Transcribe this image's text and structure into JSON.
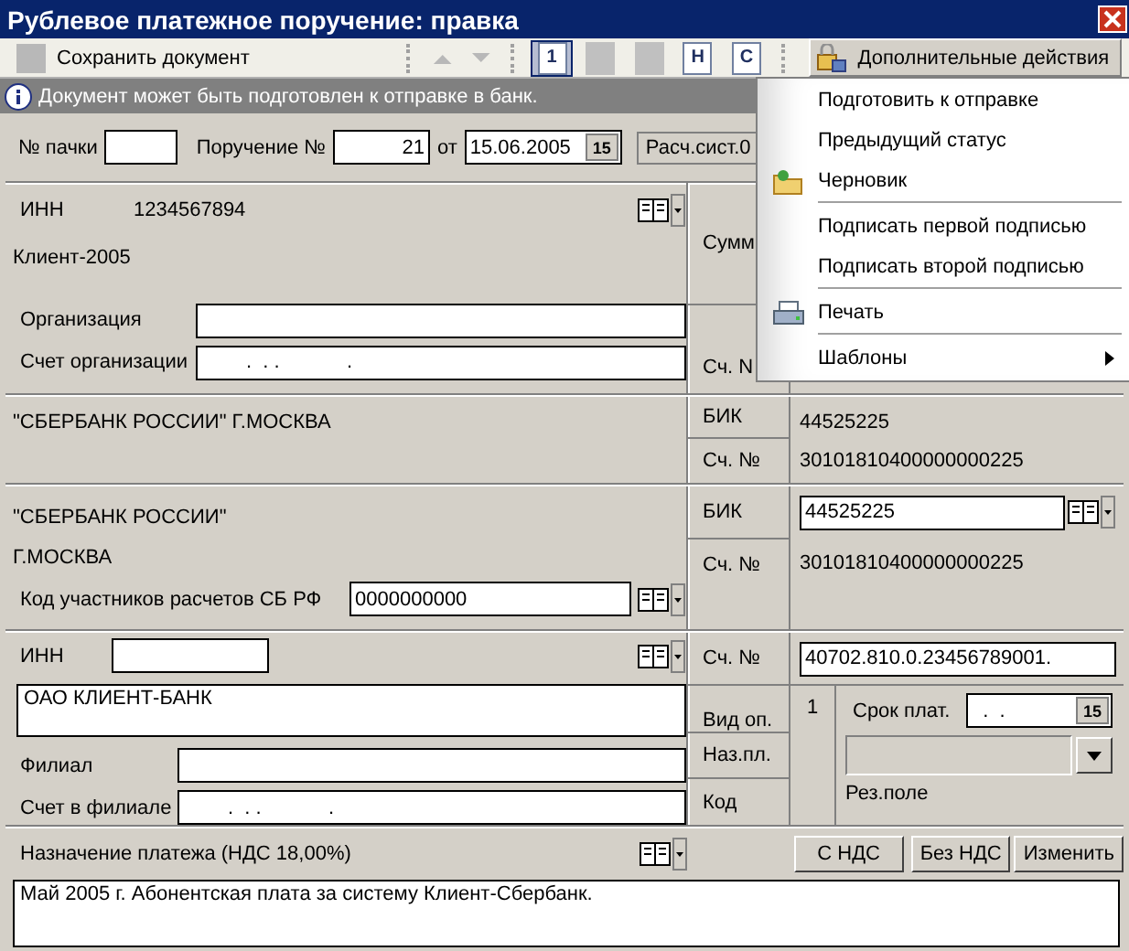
{
  "window": {
    "title": "Рублевое платежное поручение: правка"
  },
  "toolbar": {
    "save": "Сохранить документ",
    "doc_buttons": [
      {
        "kind": "letter",
        "label": "1",
        "selected": true
      },
      {
        "kind": "blank",
        "selected": false
      },
      {
        "kind": "blank",
        "selected": false
      },
      {
        "kind": "letter",
        "label": "Н",
        "selected": false
      },
      {
        "kind": "letter",
        "label": "С",
        "selected": false
      }
    ],
    "actions": {
      "label": "Дополнительные действия",
      "pressed": true
    }
  },
  "info": "Документ может быть подготовлен к отправке в банк.",
  "header": {
    "batch_label": "№ пачки",
    "order_label": "Поручение №",
    "order_number": "21",
    "date_label": "от",
    "date": "15.06.2005",
    "date_button": "15",
    "settlement": "Расч.сист.0"
  },
  "payer": {
    "inn_label": "ИНН",
    "inn": "1234567894",
    "name": "Клиент-2005",
    "org_label": "Организация",
    "account_label": "Счет организации",
    "account": "        .  . .            .",
    "amount_label": "Сумм",
    "right_account_label": "Сч. N"
  },
  "payer_bank": {
    "name": "\"СБЕРБАНК РОССИИ\" Г.МОСКВА",
    "bik_label": "БИК",
    "bik": "44525225",
    "account_label": "Сч. №",
    "account": "30101810400000000225"
  },
  "payee_bank": {
    "name": "\"СБЕРБАНК РОССИИ\"",
    "city": "Г.МОСКВА",
    "code_label": "Код участников расчетов СБ РФ",
    "code": "0000000000",
    "bik_label": "БИК",
    "bik": "44525225",
    "account_label": "Сч. №",
    "account": "30101810400000000225"
  },
  "payee": {
    "inn_label": "ИНН",
    "name": "ОАО КЛИЕНТ-БАНК",
    "branch_label": "Филиал",
    "branch_account_label": "Счет в филиале",
    "branch_account": "        .  . .            .",
    "account_label": "Сч. №",
    "account": "40702.810.0.23456789001."
  },
  "details": {
    "op_type_label": "Вид оп.",
    "op_type": "1",
    "purpose_code_label": "Наз.пл.",
    "code_label": "Код",
    "due_label": "Срок плат.",
    "due": "  .  .",
    "due_button": "15",
    "reserve_disabled": true,
    "reserve_label": "Рез.поле"
  },
  "purpose": {
    "label": "Назначение платежа (НДС 18,00%)",
    "buttons": [
      "С НДС",
      "Без НДС",
      "Изменить"
    ],
    "text": "Май 2005 г. Абонентская плата за систему Клиент-Сбербанк."
  },
  "menu": {
    "items": [
      {
        "label": "Подготовить к отправке",
        "kind": "plain",
        "separator_before": false,
        "submenu": false
      },
      {
        "label": "Предыдущий статус",
        "kind": "plain",
        "separator_before": false,
        "submenu": false
      },
      {
        "label": "Черновик",
        "kind": "folder",
        "separator_before": false,
        "submenu": false
      },
      {
        "label": "Подписать первой подписью",
        "kind": "plain",
        "separator_before": true,
        "submenu": false
      },
      {
        "label": "Подписать второй подписью",
        "kind": "plain",
        "separator_before": false,
        "submenu": false
      },
      {
        "label": "Печать",
        "kind": "printer",
        "separator_before": true,
        "submenu": false
      },
      {
        "label": "Шаблоны",
        "kind": "plain",
        "separator_before": true,
        "submenu": true
      }
    ]
  }
}
